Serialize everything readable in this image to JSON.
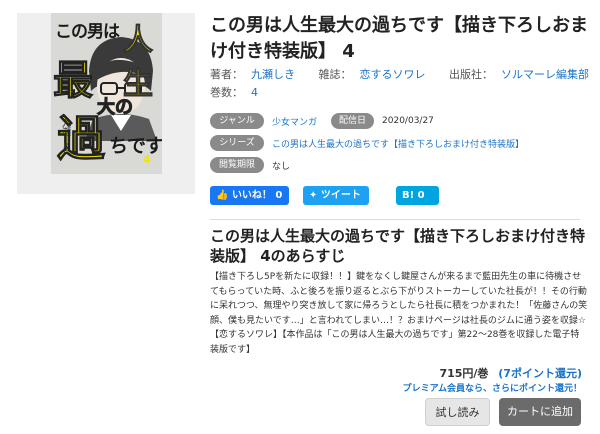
{
  "cover": {
    "title_line1": "この男は",
    "title_char_jin": "人生",
    "title_char_sai": "最",
    "title_char_dai": "大の",
    "title_char_ayama": "過",
    "title_tail": "ちです",
    "author_vertical": "九瀬しき",
    "volume": "4"
  },
  "book": {
    "title": "この男は人生最大の過ちです【描き下ろしおまけ付き特装版】 4"
  },
  "meta": {
    "author_label": "著者：",
    "author": "九瀬しき",
    "magazine_label": "雑誌：",
    "magazine": "恋するソワレ",
    "publisher_label": "出版社：",
    "publisher": "ソルマーレ編集部",
    "volumes_label": "巻数：",
    "volumes": "4"
  },
  "tags": {
    "genre_label": "ジャンル",
    "genre": "少女マンガ",
    "date_label": "配信日",
    "date": "2020/03/27",
    "series_label": "シリーズ",
    "series": "この男は人生最大の過ちです【描き下ろしおまけ付き特装版】",
    "limit_label": "閲覧期限",
    "limit": "なし"
  },
  "social": {
    "like": "いいね！ 0",
    "tweet": "ツイート",
    "hatena": "B! 0"
  },
  "synopsis": {
    "title": "この男は人生最大の過ちです【描き下ろしおまけ付き特装版】 4のあらすじ",
    "body": "【描き下ろし5Pを新たに収録！！】鍵をなくし鍵屋さんが来るまで藍田先生の車に待機させてもらっていた時、ふと後ろを振り返るとぶら下がりストーカーしていた社長が！！その行動に呆れつつ、無理やり突き放して家に帰ろうとしたら社長に積をつかまれた！「佐藤さんの笑顔、僕も見たいです…」と言われてしまい…！？おまけページは社長のジムに通う姿を収録☆【恋するソワレ】【本作品は「この男は人生最大の過ちです」第22～28巻を収録した電子特装版です】"
  },
  "purchase": {
    "price": "715円/巻",
    "points": "(7ポイント還元)",
    "premium_note": "プレミアム会員なら、さらにポイント還元！",
    "trial_label": "試し読み",
    "cart_label": "カートに追加"
  }
}
